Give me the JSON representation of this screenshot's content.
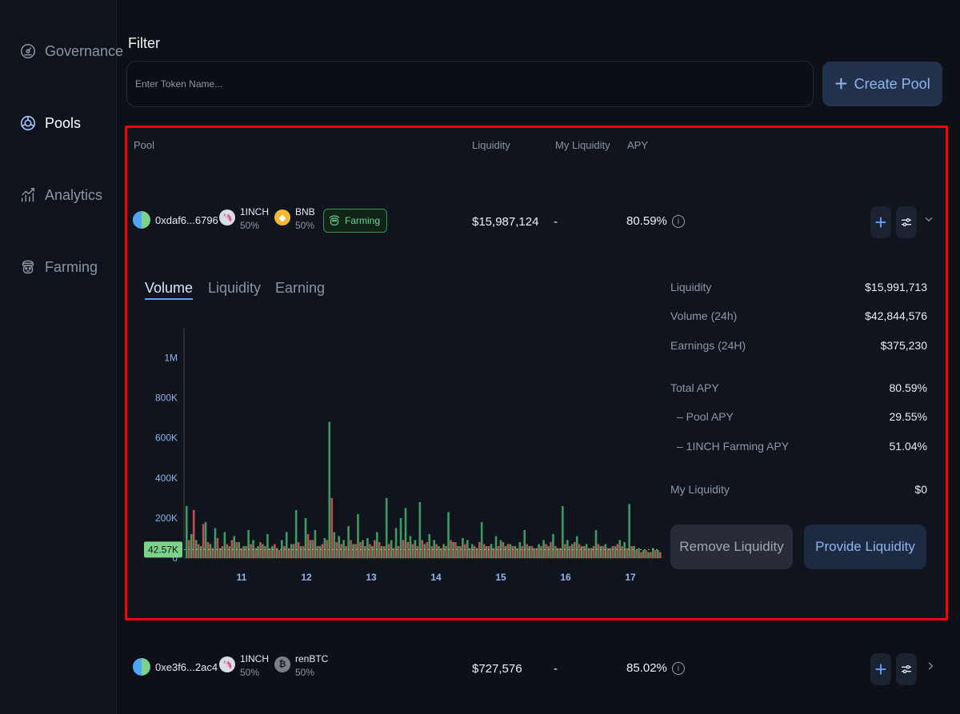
{
  "sidebar": {
    "items": [
      {
        "label": "Governance",
        "icon": "governance-icon",
        "active": false
      },
      {
        "label": "Pools",
        "icon": "pools-icon",
        "active": true
      },
      {
        "label": "Analytics",
        "icon": "analytics-icon",
        "active": false
      },
      {
        "label": "Farming",
        "icon": "farming-icon",
        "active": false
      }
    ]
  },
  "filter": {
    "label": "Filter",
    "placeholder": "Enter Token Name...",
    "create_pool_label": "Create Pool"
  },
  "table": {
    "headers": {
      "pool": "Pool",
      "liquidity": "Liquidity",
      "my_liquidity": "My Liquidity",
      "apy": "APY"
    },
    "rows": [
      {
        "address": "0xdaf6...6796",
        "token_a": {
          "name": "1INCH",
          "pct": "50%"
        },
        "token_b": {
          "name": "BNB",
          "pct": "50%"
        },
        "farming_label": "Farming",
        "liquidity": "$15,987,124",
        "my_liquidity": "-",
        "apy": "80.59%",
        "expanded": true
      },
      {
        "address": "0xe3f6...2ac4",
        "token_a": {
          "name": "1INCH",
          "pct": "50%"
        },
        "token_b": {
          "name": "renBTC",
          "pct": "50%"
        },
        "liquidity": "$727,576",
        "my_liquidity": "-",
        "apy": "85.02%",
        "expanded": false
      }
    ]
  },
  "detail": {
    "tabs": [
      {
        "label": "Volume",
        "active": true
      },
      {
        "label": "Liquidity",
        "active": false
      },
      {
        "label": "Earning",
        "active": false
      }
    ],
    "stats": {
      "liquidity_label": "Liquidity",
      "liquidity_value": "$15,991,713",
      "volume_label": "Volume (24h)",
      "volume_value": "$42,844,576",
      "earnings_label": "Earnings (24H)",
      "earnings_value": "$375,230",
      "total_apy_label": "Total APY",
      "total_apy_value": "80.59%",
      "pool_apy_label": "– Pool APY",
      "pool_apy_value": "29.55%",
      "farming_apy_label": "– 1INCH Farming APY",
      "farming_apy_value": "51.04%",
      "my_liquidity_label": "My Liquidity",
      "my_liquidity_value": "$0"
    },
    "remove_label": "Remove Liquidity",
    "provide_label": "Provide Liquidity"
  },
  "colors": {
    "up": "#3f9b63",
    "down": "#c0504f",
    "accent": "#5fa0ff"
  },
  "chart_data": {
    "type": "bar",
    "x_ticks": [
      "11",
      "12",
      "13",
      "14",
      "15",
      "16",
      "17"
    ],
    "y_ticks": [
      "0",
      "200K",
      "400K",
      "600K",
      "800K",
      "1M"
    ],
    "ylim": [
      0,
      1150000
    ],
    "current_label": "42.57K",
    "current_value": 42570,
    "series": [
      {
        "name": "up",
        "values": [
          260000,
          120000,
          90000,
          60000,
          180000,
          70000,
          150000,
          50000,
          130000,
          60000,
          110000,
          80000,
          60000,
          140000,
          90000,
          60000,
          70000,
          120000,
          60000,
          50000,
          90000,
          130000,
          70000,
          240000,
          60000,
          200000,
          90000,
          140000,
          60000,
          100000,
          680000,
          130000,
          110000,
          90000,
          160000,
          70000,
          220000,
          90000,
          100000,
          60000,
          130000,
          60000,
          300000,
          90000,
          150000,
          200000,
          250000,
          110000,
          90000,
          280000,
          70000,
          120000,
          90000,
          60000,
          70000,
          230000,
          80000,
          60000,
          100000,
          90000,
          70000,
          50000,
          180000,
          60000,
          70000,
          110000,
          90000,
          60000,
          70000,
          60000,
          80000,
          140000,
          60000,
          50000,
          70000,
          90000,
          60000,
          120000,
          50000,
          260000,
          90000,
          70000,
          110000,
          60000,
          70000,
          50000,
          140000,
          60000,
          70000,
          50000,
          60000,
          90000,
          80000,
          270000,
          60000,
          50000,
          40000,
          30000,
          50000,
          40000
        ]
      },
      {
        "name": "down",
        "values": [
          90000,
          240000,
          70000,
          170000,
          80000,
          50000,
          100000,
          60000,
          70000,
          90000,
          80000,
          50000,
          60000,
          70000,
          50000,
          80000,
          60000,
          50000,
          70000,
          40000,
          60000,
          50000,
          70000,
          80000,
          60000,
          120000,
          90000,
          60000,
          70000,
          90000,
          300000,
          80000,
          70000,
          60000,
          90000,
          70000,
          80000,
          60000,
          70000,
          90000,
          80000,
          60000,
          70000,
          50000,
          60000,
          90000,
          80000,
          70000,
          60000,
          90000,
          80000,
          60000,
          70000,
          50000,
          60000,
          90000,
          80000,
          60000,
          70000,
          50000,
          60000,
          80000,
          70000,
          60000,
          50000,
          60000,
          80000,
          70000,
          60000,
          50000,
          60000,
          70000,
          60000,
          50000,
          60000,
          70000,
          80000,
          60000,
          50000,
          70000,
          60000,
          80000,
          70000,
          60000,
          50000,
          60000,
          70000,
          60000,
          50000,
          60000,
          70000,
          60000,
          50000,
          60000,
          40000,
          30000,
          40000,
          30000,
          40000,
          30000
        ]
      }
    ]
  }
}
